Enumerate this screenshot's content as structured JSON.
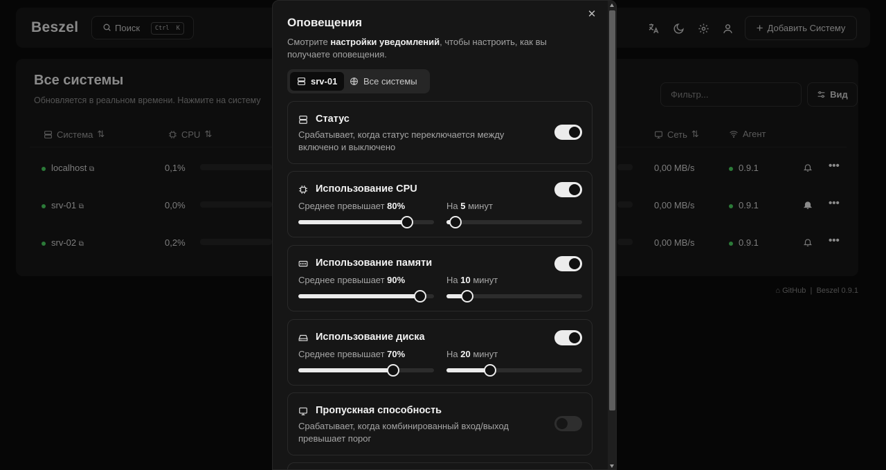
{
  "app": {
    "logo": "Beszel",
    "search": {
      "label": "Поиск",
      "shortcut_ctrl": "Ctrl",
      "shortcut_key": "K"
    },
    "add_system_label": "Добавить Систему",
    "icons": [
      "translate-icon",
      "moon-icon",
      "gear-icon",
      "user-icon"
    ]
  },
  "systems": {
    "title": "Все системы",
    "subtitle": "Обновляется в реальном времени. Нажмите на систему",
    "filter_placeholder": "Фильтр...",
    "view_label": "Вид",
    "columns": {
      "system": "Система",
      "cpu": "CPU",
      "net": "Сеть",
      "agent": "Агент"
    },
    "rows": [
      {
        "name": "localhost",
        "cpu": "0,1%",
        "cpu_fraction": 0.001,
        "net": "0,00 MB/s",
        "agent": "0.9.1",
        "bell_active": false
      },
      {
        "name": "srv-01",
        "cpu": "0,0%",
        "cpu_fraction": 0.0,
        "net": "0,00 MB/s",
        "agent": "0.9.1",
        "bell_active": true
      },
      {
        "name": "srv-02",
        "cpu": "0,2%",
        "cpu_fraction": 0.002,
        "net": "0,00 MB/s",
        "agent": "0.9.1",
        "bell_active": false
      }
    ]
  },
  "footer": {
    "github": "GitHub",
    "separator": "|",
    "version": "Beszel 0.9.1"
  },
  "modal": {
    "title": "Оповещения",
    "desc_prefix": "Смотрите ",
    "desc_link": "настройки уведомлений",
    "desc_suffix": ", чтобы настроить, как вы получаете оповещения.",
    "tabs": [
      {
        "label": "srv-01",
        "active": true
      },
      {
        "label": "Все системы",
        "active": false
      }
    ],
    "alerts": [
      {
        "title": "Статус",
        "desc": "Срабатывает, когда статус переключается между включено и выключено",
        "enabled": true
      },
      {
        "title": "Использование CPU",
        "enabled": true,
        "threshold_prefix": "Среднее превышает ",
        "threshold": "80%",
        "threshold_value": 80,
        "duration_prefix": "На ",
        "duration": "5",
        "duration_suffix": " минут",
        "duration_value": 5
      },
      {
        "title": "Использование памяти",
        "enabled": true,
        "threshold_prefix": "Среднее превышает ",
        "threshold": "90%",
        "threshold_value": 90,
        "duration_prefix": "На ",
        "duration": "10",
        "duration_suffix": " минут",
        "duration_value": 10
      },
      {
        "title": "Использование диска",
        "enabled": true,
        "threshold_prefix": "Среднее превышает ",
        "threshold": "70%",
        "threshold_value": 70,
        "duration_prefix": "На ",
        "duration": "20",
        "duration_suffix": " минут",
        "duration_value": 20
      },
      {
        "title": "Пропускная способность",
        "desc": "Срабатывает, когда комбинированный вход/выход превышает порог",
        "enabled": false
      }
    ]
  },
  "colors": {
    "accent": "#ececec",
    "status_up": "#2b7a38",
    "modal_bg": "#161616",
    "page_bg": "#060606"
  }
}
